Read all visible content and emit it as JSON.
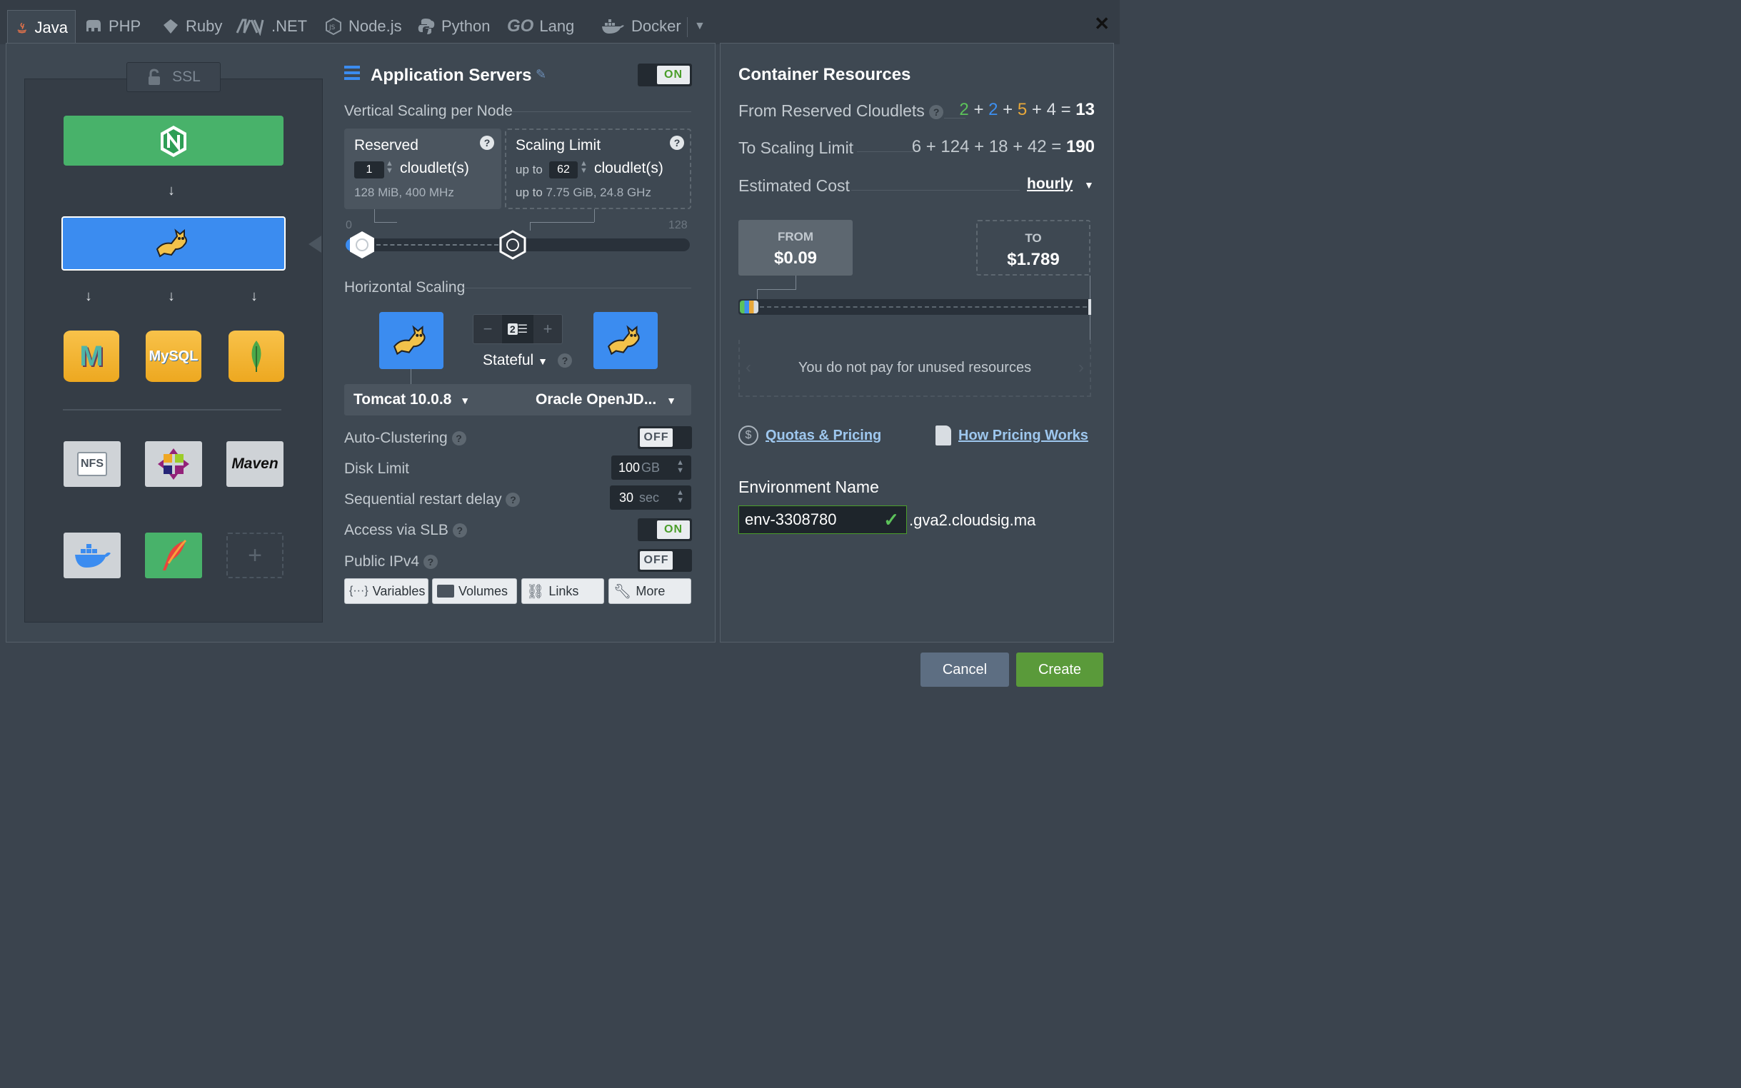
{
  "tabs": [
    {
      "label": "Java",
      "icon": "java-icon",
      "active": true
    },
    {
      "label": "PHP",
      "icon": "php-elephant-icon"
    },
    {
      "label": "Ruby",
      "icon": "ruby-gem-icon"
    },
    {
      "label": ".NET",
      "icon": "dotnet-icon"
    },
    {
      "label": "Node.js",
      "icon": "nodejs-icon"
    },
    {
      "label": "Python",
      "icon": "python-icon"
    },
    {
      "label": "Lang",
      "icon": "go-icon",
      "prefix": "GO"
    },
    {
      "label": "Docker",
      "icon": "docker-whale-icon"
    }
  ],
  "topology": {
    "ssl_label": "SSL",
    "tiles": {
      "nfs": "NFS",
      "maven": "Maven"
    },
    "db": {
      "mysql": "MySQL",
      "mariadb": "M"
    }
  },
  "app_servers": {
    "title": "Application Servers",
    "toggle": "ON",
    "vertical_label": "Vertical Scaling per Node",
    "reserved": {
      "title": "Reserved",
      "value": "1",
      "unit": "cloudlet(s)",
      "info": "128 MiB, 400 MHz"
    },
    "limit": {
      "title": "Scaling Limit",
      "prefix": "up to",
      "value": "62",
      "unit": "cloudlet(s)",
      "info_prefix": "up to",
      "info": "7.75 GiB, 24.8 GHz"
    },
    "slider": {
      "min": "0",
      "max": "128",
      "reserved": 1,
      "limit": 62
    },
    "horizontal_label": "Horizontal Scaling",
    "node_count": "2",
    "minus": "−",
    "plus": "+",
    "mode": "Stateful",
    "server": "Tomcat 10.0.8",
    "jdk": "Oracle OpenJD...",
    "auto_clustering": {
      "label": "Auto-Clustering",
      "value": "OFF"
    },
    "disk_limit": {
      "label": "Disk Limit",
      "value": "100",
      "unit": "GB"
    },
    "restart_delay": {
      "label": "Sequential restart delay",
      "value": "30",
      "unit": "sec"
    },
    "slb": {
      "label": "Access via SLB",
      "value": "ON"
    },
    "ipv4": {
      "label": "Public IPv4",
      "value": "OFF"
    },
    "buttons": {
      "variables": "Variables",
      "volumes": "Volumes",
      "links": "Links",
      "more": "More"
    }
  },
  "resources": {
    "title": "Container Resources",
    "reserved_label": "From Reserved Cloudlets",
    "reserved_parts": [
      "2",
      "2",
      "5",
      "4"
    ],
    "reserved_colors": [
      "#5cc25a",
      "#3d8ff0",
      "#e8a83a",
      "#d8dde2"
    ],
    "reserved_total": "13",
    "limit_label": "To Scaling Limit",
    "limit_parts": [
      "6",
      "124",
      "18",
      "42"
    ],
    "limit_total": "190",
    "cost_label": "Estimated Cost",
    "cost_period": "hourly",
    "from_label": "FROM",
    "from_value": "$0.09",
    "to_label": "TO",
    "to_value": "$1.789",
    "unused_note": "You do not pay for unused resources",
    "quotas_link": "Quotas & Pricing",
    "pricing_link": "How Pricing Works",
    "env_label": "Environment Name",
    "env_value": "env-3308780",
    "env_domain": ".gva2.cloudsig.ma"
  },
  "footer": {
    "cancel": "Cancel",
    "create": "Create"
  },
  "colors": {
    "accent_blue": "#3b8cf0",
    "green": "#5a9a3a",
    "nginx": "#48b26a",
    "db": "#f2b02c"
  }
}
